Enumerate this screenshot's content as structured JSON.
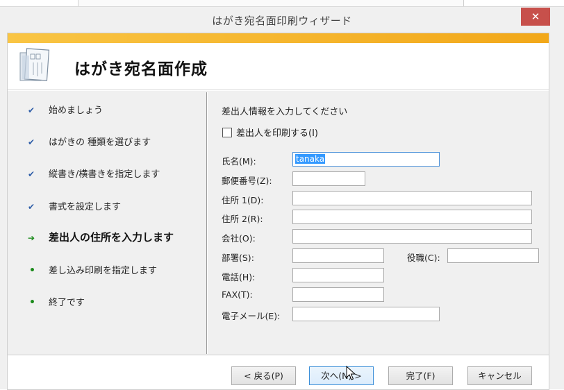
{
  "window": {
    "title": "はがき宛名面印刷ウィザード",
    "close_label": "✕"
  },
  "header": {
    "title": "はがき宛名面作成",
    "icon": "postcard-document-icon"
  },
  "steps": [
    {
      "label": "始めましょう",
      "state": "done"
    },
    {
      "label": "はがきの 種類を選びます",
      "state": "done"
    },
    {
      "label": "縦書き/横書きを指定します",
      "state": "done"
    },
    {
      "label": "書式を設定します",
      "state": "done"
    },
    {
      "label": "差出人の住所を入力します",
      "state": "current"
    },
    {
      "label": "差し込み印刷を指定します",
      "state": "pending"
    },
    {
      "label": "終了です",
      "state": "pending"
    }
  ],
  "step_marks": {
    "done": "✔",
    "current": "➔",
    "pending": "•"
  },
  "form": {
    "instruction": "差出人情報を入力してください",
    "print_sender_label": "差出人を印刷する(I)",
    "print_sender_checked": false,
    "fields": {
      "name": {
        "label": "氏名(M):",
        "value": "tanaka"
      },
      "postal": {
        "label": "郵便番号(Z):",
        "value": ""
      },
      "address1": {
        "label": "住所 1(D):",
        "value": ""
      },
      "address2": {
        "label": "住所 2(R):",
        "value": ""
      },
      "company": {
        "label": "会社(O):",
        "value": ""
      },
      "department": {
        "label": "部署(S):",
        "value": ""
      },
      "title": {
        "label": "役職(C):",
        "value": ""
      },
      "phone": {
        "label": "電話(H):",
        "value": ""
      },
      "fax": {
        "label": "FAX(T):",
        "value": ""
      },
      "email": {
        "label": "電子メール(E):",
        "value": ""
      }
    }
  },
  "buttons": {
    "back": "< 戻る(P)",
    "next": "次へ(N) >",
    "finish": "完了(F)",
    "cancel": "キャンセル"
  },
  "colors": {
    "accent": "#f2a81a",
    "close": "#c7504b",
    "check": "#2f5ea8",
    "arrow": "#1a8a1a"
  }
}
